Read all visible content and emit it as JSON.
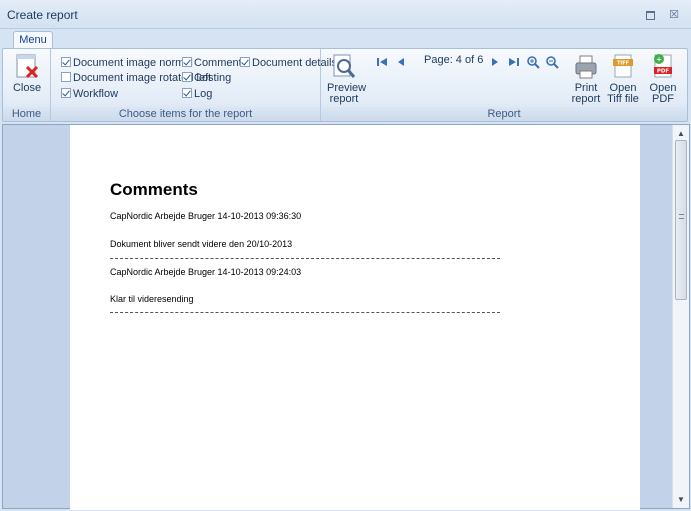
{
  "window": {
    "title": "Create report",
    "restore_icon": "restore-icon",
    "close_glyph": "☒"
  },
  "tabs": [
    {
      "label": "Menu"
    }
  ],
  "ribbon": {
    "home": {
      "group_label": "Home",
      "close_label": "Close"
    },
    "items": {
      "group_label": "Choose items for the report",
      "checkboxes": [
        {
          "label": "Document image normal",
          "checked": true
        },
        {
          "label": "Document image rotated left",
          "checked": false
        },
        {
          "label": "Workflow",
          "checked": true
        },
        {
          "label": "Comments",
          "checked": true
        },
        {
          "label": "Costing",
          "checked": true
        },
        {
          "label": "Log",
          "checked": true
        },
        {
          "label": "Document details",
          "checked": true
        }
      ]
    },
    "report": {
      "group_label": "Report",
      "preview_label_1": "Preview",
      "preview_label_2": "report",
      "page_info": "Page: 4 of 6",
      "print_label_1": "Print",
      "print_label_2": "report",
      "tiff_label_1": "Open",
      "tiff_label_2": "Tiff file",
      "tiff_badge": "TIFF",
      "pdf_label_1": "Open",
      "pdf_label_2": "PDF",
      "pdf_badge": "PDF"
    }
  },
  "document": {
    "title": "Comments",
    "entries": [
      {
        "header": "CapNordic Arbejde Bruger 14-10-2013 09:36:30",
        "text": "Dokument bliver sendt videre den 20/10-2013"
      },
      {
        "header": "CapNordic Arbejde Bruger 14-10-2013 09:24:03",
        "text": "Klar til videresending"
      }
    ]
  },
  "colors": {
    "ribbon_bg": "#e3ecf7",
    "accent": "#15428b",
    "pdf_red": "#d8232a"
  }
}
